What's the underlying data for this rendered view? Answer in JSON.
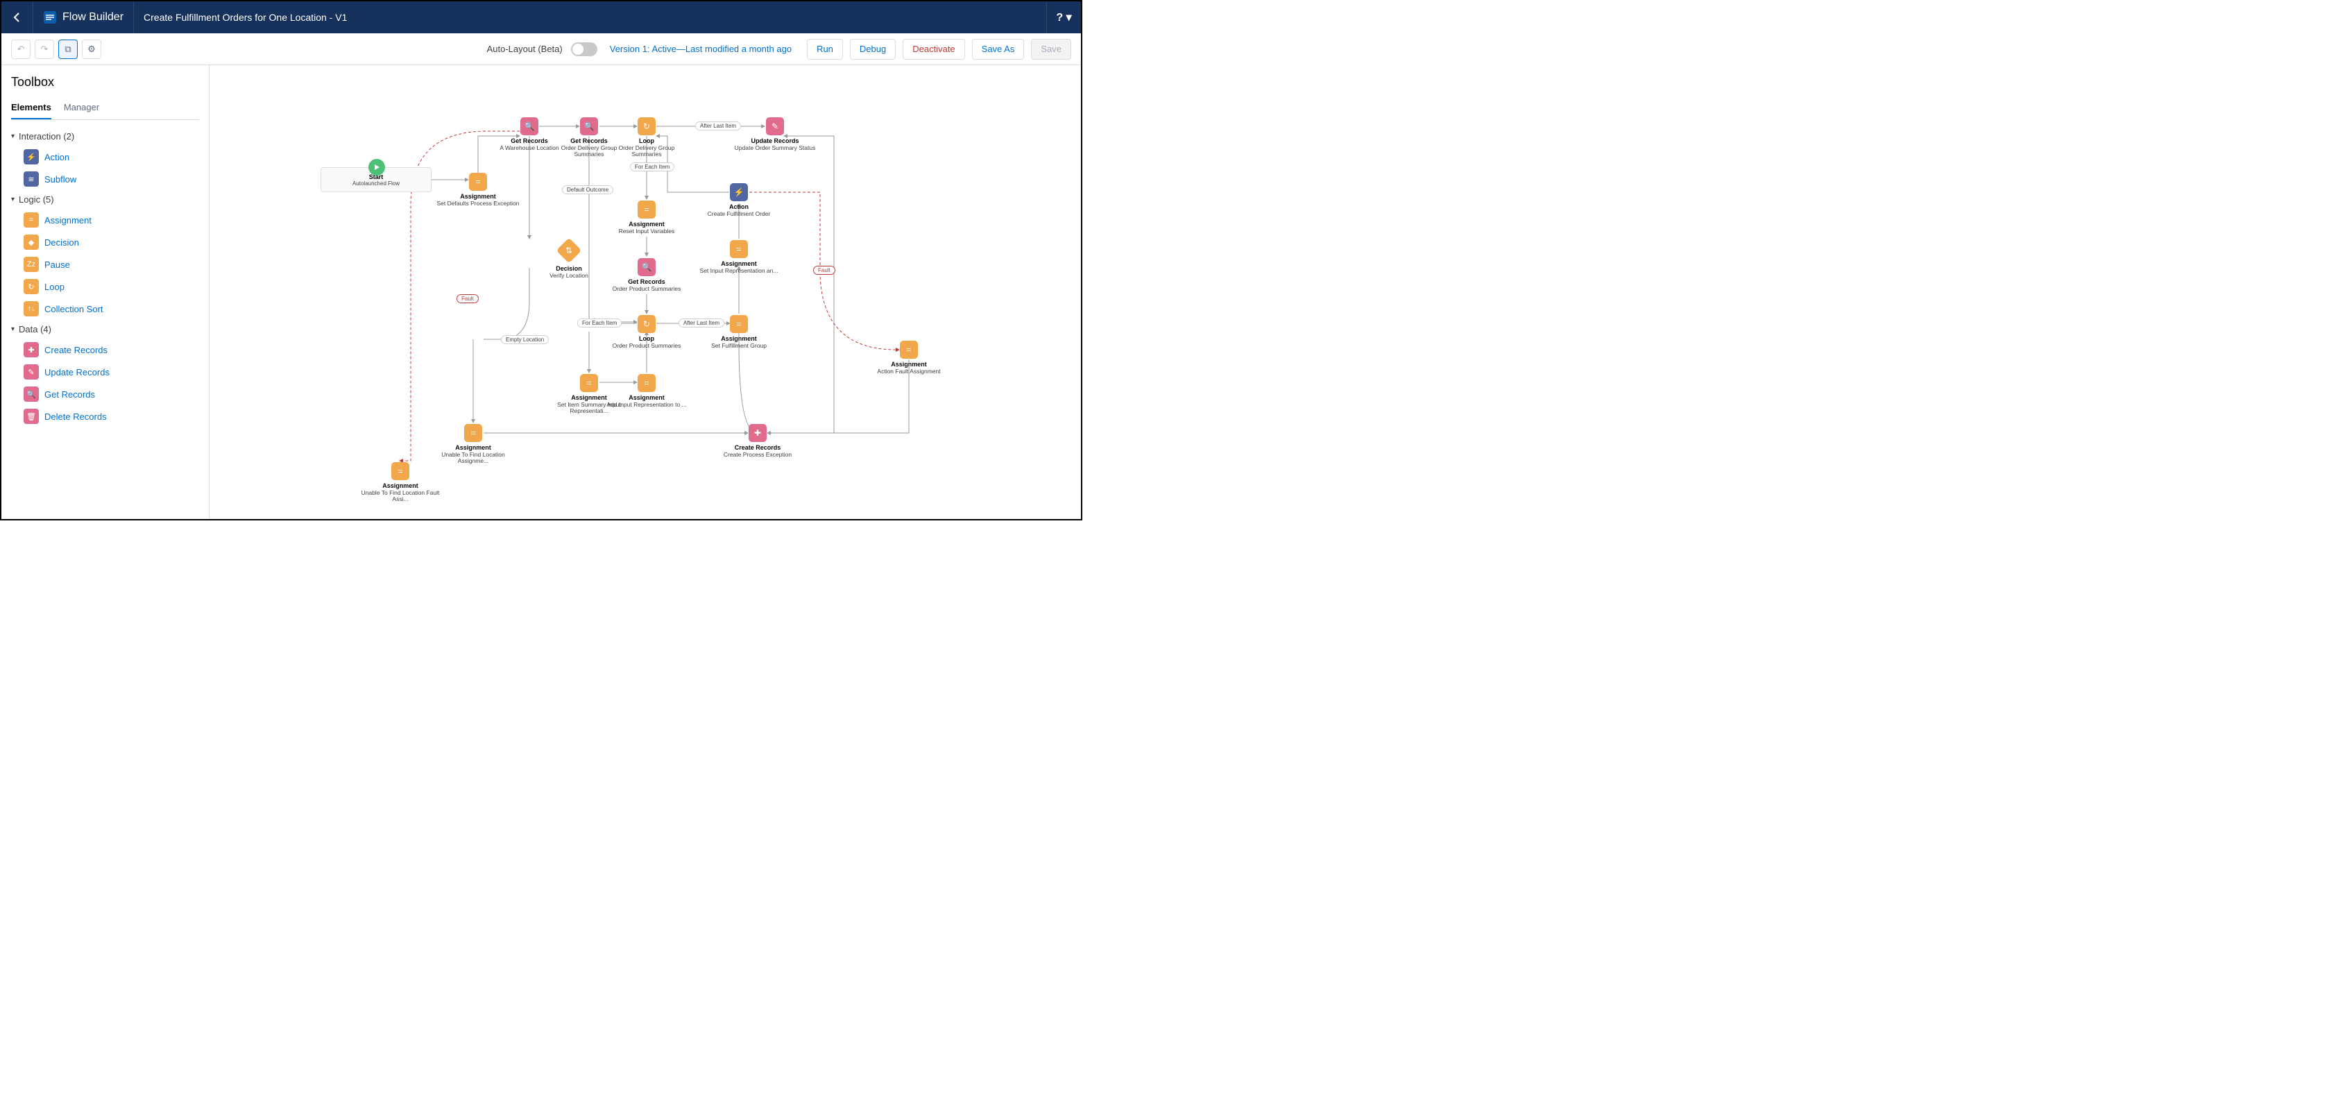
{
  "header": {
    "brand": "Flow Builder",
    "title": "Create Fulfillment Orders for One Location - V1",
    "help": "? ▾"
  },
  "actionbar": {
    "auto_layout": "Auto-Layout (Beta)",
    "version": "Version 1: Active—Last modified a month ago",
    "run": "Run",
    "debug": "Debug",
    "deactivate": "Deactivate",
    "save_as": "Save As",
    "save": "Save"
  },
  "sidebar": {
    "title": "Toolbox",
    "tabs": {
      "elements": "Elements",
      "manager": "Manager"
    },
    "groups": [
      {
        "name": "Interaction (2)",
        "items": [
          {
            "label": "Action",
            "icon": "⚡",
            "color": "#5067a3"
          },
          {
            "label": "Subflow",
            "icon": "≋",
            "color": "#5067a3"
          }
        ]
      },
      {
        "name": "Logic (5)",
        "items": [
          {
            "label": "Assignment",
            "icon": "=",
            "color": "#f2a74b"
          },
          {
            "label": "Decision",
            "icon": "◆",
            "color": "#f2a74b"
          },
          {
            "label": "Pause",
            "icon": "Zz",
            "color": "#f2a74b"
          },
          {
            "label": "Loop",
            "icon": "↻",
            "color": "#f2a74b"
          },
          {
            "label": "Collection Sort",
            "icon": "↑↓",
            "color": "#f2a74b"
          }
        ]
      },
      {
        "name": "Data (4)",
        "items": [
          {
            "label": "Create Records",
            "icon": "✚",
            "color": "#e16b8c"
          },
          {
            "label": "Update Records",
            "icon": "✎",
            "color": "#e16b8c"
          },
          {
            "label": "Get Records",
            "icon": "🔍",
            "color": "#e16b8c"
          },
          {
            "label": "Delete Records",
            "icon": "🗑",
            "color": "#e16b8c"
          }
        ]
      }
    ]
  },
  "canvas": {
    "start": {
      "title": "Start",
      "sub": "Autolaunched Flow"
    },
    "nodes": {
      "asgDefaults": {
        "title": "Assignment",
        "sub": "Set Defaults Process Exception"
      },
      "getWarehouse": {
        "title": "Get Records",
        "sub": "A Warehouse Location"
      },
      "getOdgs": {
        "title": "Get Records",
        "sub": "Order Delivery Group Summaries"
      },
      "loopOdgs": {
        "title": "Loop",
        "sub": "Order Delivery Group Summaries"
      },
      "updStatus": {
        "title": "Update Records",
        "sub": "Update Order Summary Status"
      },
      "asgReset": {
        "title": "Assignment",
        "sub": "Reset Input Variables"
      },
      "getOps": {
        "title": "Get Records",
        "sub": "Order Product Summaries"
      },
      "decision": {
        "title": "Decision",
        "sub": "Verify Location"
      },
      "action": {
        "title": "Action",
        "sub": "Create Fulfillment Order"
      },
      "asgSetInput": {
        "title": "Assignment",
        "sub": "Set Input Representation an..."
      },
      "loopOps": {
        "title": "Loop",
        "sub": "Order Product Summaries"
      },
      "asgFulfill": {
        "title": "Assignment",
        "sub": "Set Fulfillment Group"
      },
      "asgItemSum": {
        "title": "Assignment",
        "sub": "Set Item Summary Input Representati..."
      },
      "asgAddInput": {
        "title": "Assignment",
        "sub": "Add Input Representation to ..."
      },
      "asgUnable": {
        "title": "Assignment",
        "sub": "Unable To Find Location Assignme..."
      },
      "asgFault": {
        "title": "Assignment",
        "sub": "Unable To Find Location Fault Assi..."
      },
      "createPE": {
        "title": "Create Records",
        "sub": "Create Process Exception"
      },
      "asgActionFault": {
        "title": "Assignment",
        "sub": "Action Fault Assignment"
      }
    },
    "labels": {
      "defaultOutcome": "Default Outcome",
      "forEachItem": "For Each Item",
      "afterLastItem": "After Last Item",
      "emptyLocation": "Empty Location",
      "fault": "Fault"
    }
  }
}
